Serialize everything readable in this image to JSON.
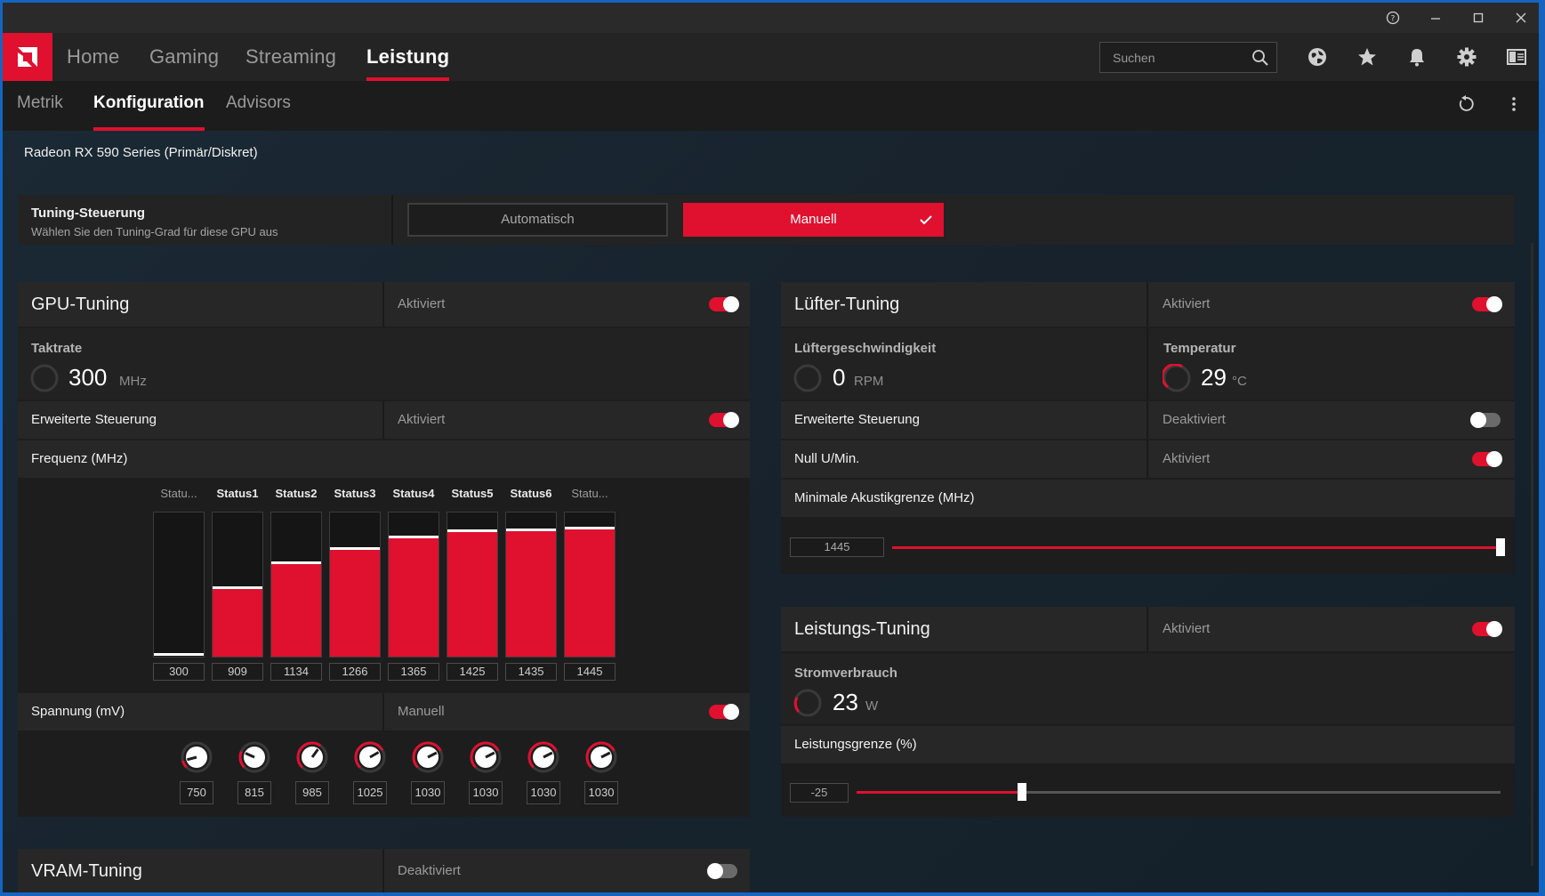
{
  "nav": {
    "items": [
      "Home",
      "Gaming",
      "Streaming",
      "Leistung"
    ],
    "active": "Leistung",
    "search_placeholder": "Suchen"
  },
  "subnav": {
    "items": [
      "Metrik",
      "Konfiguration",
      "Advisors"
    ],
    "active": "Konfiguration"
  },
  "device": "Radeon RX 590 Series (Primär/Diskret)",
  "tuning_control": {
    "title": "Tuning-Steuerung",
    "subtitle": "Wählen Sie den Tuning-Grad für diese GPU aus",
    "auto_label": "Automatisch",
    "manual_label": "Manuell",
    "selected": "Manuell"
  },
  "gpu_tuning": {
    "title": "GPU-Tuning",
    "status": "Aktiviert",
    "enabled": true,
    "clock_label": "Taktrate",
    "clock_value": "300",
    "clock_unit": "MHz",
    "advanced_label": "Erweiterte Steuerung",
    "advanced_status": "Aktiviert",
    "advanced_enabled": true,
    "freq_label": "Frequenz (MHz)",
    "freq_states": [
      {
        "label": "Statu...",
        "value": "300"
      },
      {
        "label": "Status1",
        "value": "909"
      },
      {
        "label": "Status2",
        "value": "1134"
      },
      {
        "label": "Status3",
        "value": "1266"
      },
      {
        "label": "Status4",
        "value": "1365"
      },
      {
        "label": "Status5",
        "value": "1425"
      },
      {
        "label": "Status6",
        "value": "1435"
      },
      {
        "label": "Statu...",
        "value": "1445"
      }
    ],
    "voltage_label": "Spannung (mV)",
    "voltage_status": "Manuell",
    "voltage_enabled": true,
    "voltages": [
      "750",
      "815",
      "985",
      "1025",
      "1030",
      "1030",
      "1030",
      "1030"
    ]
  },
  "vram_tuning": {
    "title": "VRAM-Tuning",
    "status": "Deaktiviert",
    "enabled": false
  },
  "fan_tuning": {
    "title": "Lüfter-Tuning",
    "status": "Aktiviert",
    "enabled": true,
    "speed_label": "Lüftergeschwindigkeit",
    "speed_value": "0",
    "speed_unit": "RPM",
    "temp_label": "Temperatur",
    "temp_value": "29",
    "temp_unit": "°C",
    "advanced_label": "Erweiterte Steuerung",
    "advanced_status": "Deaktiviert",
    "advanced_enabled": false,
    "zero_rpm_label": "Null U/Min.",
    "zero_rpm_status": "Aktiviert",
    "zero_rpm_enabled": true,
    "min_acoustic_label": "Minimale Akustikgrenze (MHz)",
    "min_acoustic_value": "1445"
  },
  "power_tuning": {
    "title": "Leistungs-Tuning",
    "status": "Aktiviert",
    "enabled": true,
    "power_label": "Stromverbrauch",
    "power_value": "23",
    "power_unit": "W",
    "limit_label": "Leistungsgrenze (%)",
    "limit_value": "-25"
  },
  "colors": {
    "accent": "#e0102f",
    "panel": "#1d1d1d",
    "header": "#272727"
  }
}
